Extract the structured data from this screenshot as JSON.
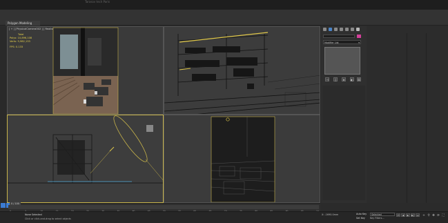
{
  "window": {
    "title": "Untitled - Autodesk 3ds Max",
    "title_visible": "Tarasov tech Paris"
  },
  "ribbon": {
    "tab_label": "Polygon Modeling"
  },
  "viewports": {
    "top_left": {
      "label": "[ + ] [PhysicalCamera002 ] [ Realistic ]"
    },
    "top_right": {
      "label": "[ + ] [PhysicalCamera001 ] [ Wireframe ]"
    },
    "bottom_left": {
      "label": "[ + ] [ Left ] [ Wireframe ]"
    },
    "bottom_right": {
      "label": "[ + ] [PhysicalCamera003 ] [ Wireframe ]"
    }
  },
  "stats": {
    "header": "Total",
    "polys_label": "Polys:",
    "polys_value": "10,896,108",
    "verts_label": "Verts:",
    "verts_value": "9,982,133",
    "fps_label": "FPS:",
    "fps_value": "0.133"
  },
  "command_panel": {
    "name_field": "",
    "modifier_list": "Modifier List",
    "modifier_arrow": "▾",
    "stack_buttons": [
      "⊣",
      "|",
      "⋔",
      "◐",
      "⚿"
    ]
  },
  "timeline": {
    "frame_counter": "0 / 100",
    "ticks": [
      "0",
      "5",
      "10",
      "15",
      "20",
      "25",
      "30",
      "35",
      "40",
      "45",
      "50",
      "55",
      "60",
      "65",
      "70",
      "75",
      "80",
      "85",
      "90",
      "95",
      "100"
    ]
  },
  "status": {
    "selection": "None Selected",
    "prompt": "Click or click-and-drag to select objects",
    "coord_x": "X: -1690.0mm",
    "coord_y": "Y: 0.0mm",
    "coord_z": "Z: 0.0mm",
    "autokey": "Auto Key",
    "setkey": "Set Key",
    "selected_dropdown": "Selected",
    "key_filters": "Key Filters..."
  },
  "playback": [
    "⏮",
    "◀",
    "▶",
    "▶|",
    "⏭"
  ],
  "nav": [
    "+",
    "⚲",
    "✥",
    "⟳",
    "⛶"
  ],
  "colors": {
    "accent_yellow": "#c8b44a",
    "object_color": "#d4409a",
    "icon_blue": "#3b7cd4"
  }
}
